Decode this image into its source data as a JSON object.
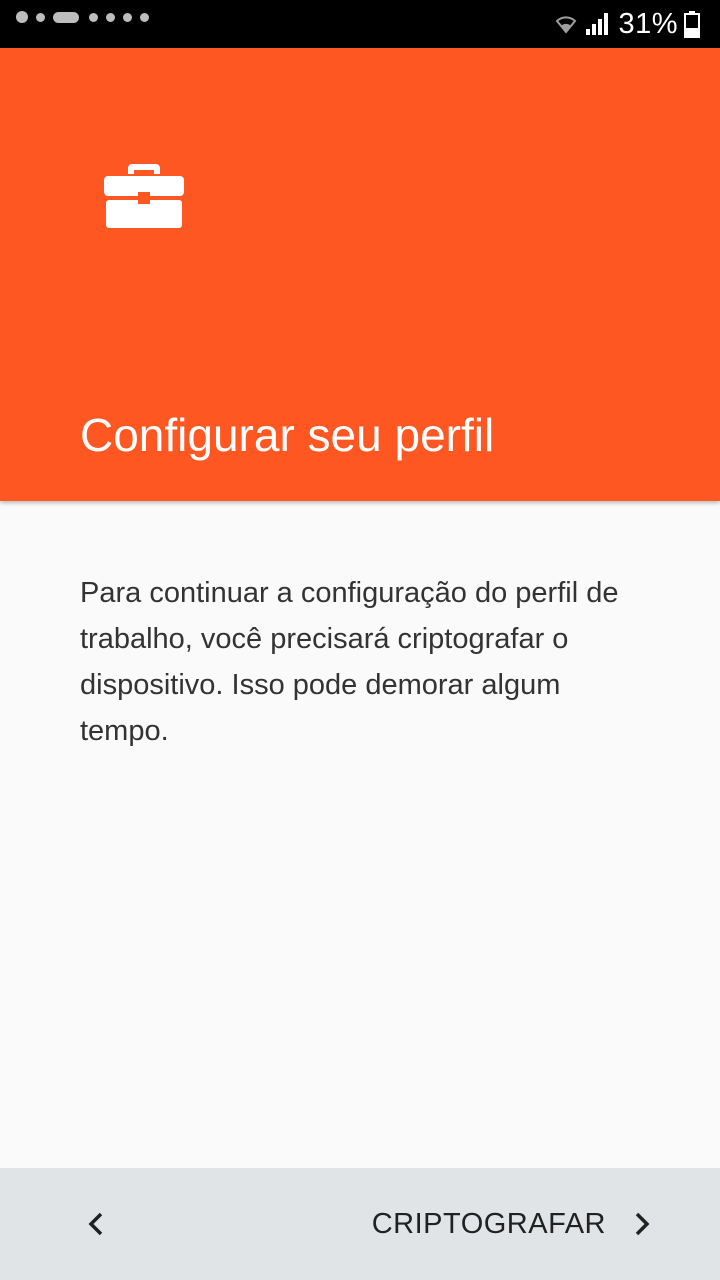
{
  "status_bar": {
    "battery_percent": "31%",
    "icons": [
      "notification-dot",
      "notification-dot",
      "notification-pill",
      "notification-dot",
      "notification-dot",
      "notification-dot",
      "notification-dot",
      "wifi-icon",
      "signal-icon",
      "battery-icon"
    ]
  },
  "header": {
    "icon": "briefcase-icon",
    "title": "Configurar seu perfil",
    "accent_color": "#ff5722"
  },
  "content": {
    "message": "Para continuar a configuração do perfil de trabalho, você precisará criptografar o dispositivo. Isso pode demorar algum tempo."
  },
  "footer": {
    "back_icon": "chevron-left-icon",
    "next_label": "CRIPTOGRAFAR",
    "next_icon": "chevron-right-icon"
  }
}
